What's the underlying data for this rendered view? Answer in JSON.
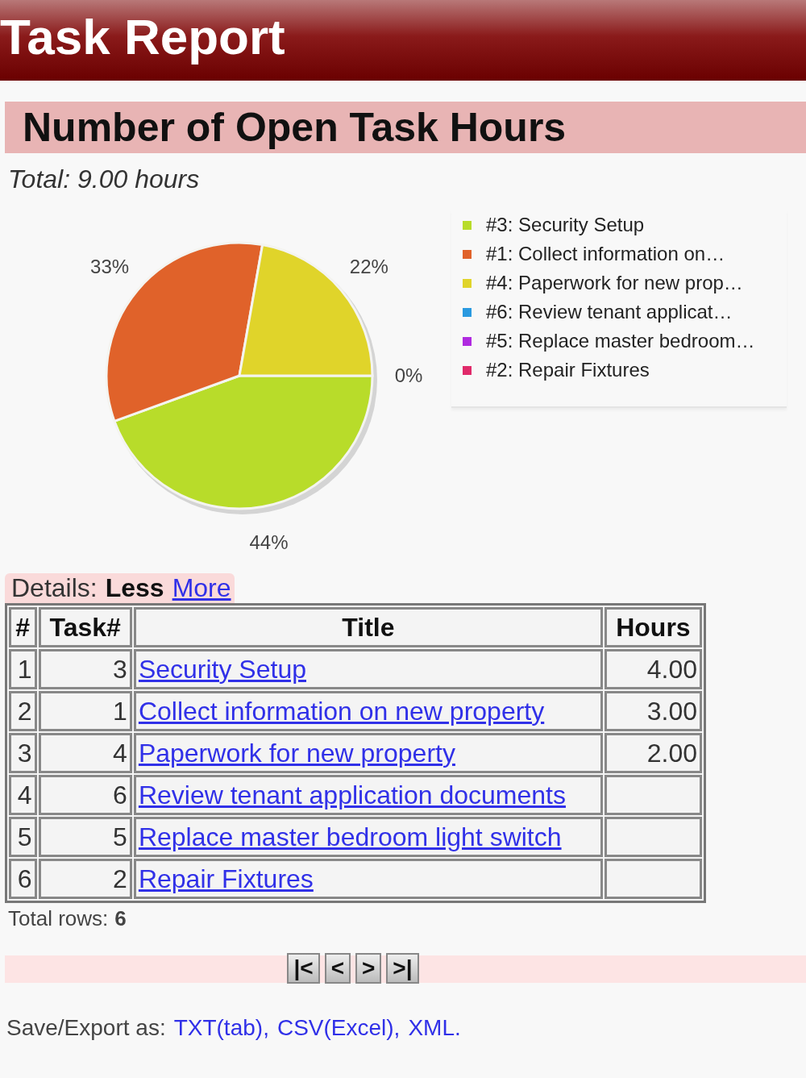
{
  "header": {
    "title": "Task Report"
  },
  "section": {
    "heading": "Number of Open Task Hours",
    "total": "Total: 9.00 hours",
    "chart_data": {
      "type": "pie",
      "categories": [
        "#3: Security Setup",
        "#1: Collect information on…",
        "#4: Paperwork for new prop…",
        "#6: Review tenant applicat…",
        "#5: Replace master bedroom…",
        "#2: Repair Fixtures"
      ],
      "values": [
        44,
        33,
        22,
        0,
        0,
        0
      ],
      "legend": "right",
      "colors": [
        "#b8dc2a",
        "#e0622a",
        "#e0d42a",
        "#2a9ae0",
        "#b02ae0",
        "#e02a6a"
      ],
      "value_labels": [
        "44%",
        "33%",
        "22%",
        "0%",
        null,
        null
      ]
    }
  },
  "details": {
    "label": "Details:",
    "options": [
      {
        "label": "Less",
        "selected": true
      },
      {
        "label": "More",
        "selected": false
      }
    ]
  },
  "table": {
    "columns": [
      "#",
      "Task#",
      "Title",
      "Hours"
    ],
    "rows": [
      {
        "index": "1",
        "task": "3",
        "title": "Security Setup",
        "hours": "4.00"
      },
      {
        "index": "2",
        "task": "1",
        "title": "Collect information on new property",
        "hours": "3.00"
      },
      {
        "index": "3",
        "task": "4",
        "title": "Paperwork for new property",
        "hours": "2.00"
      },
      {
        "index": "4",
        "task": "6",
        "title": "Review tenant application documents"
      },
      {
        "index": "5",
        "task": "5",
        "title": "Replace master bedroom light switch"
      },
      {
        "index": "6",
        "task": "2",
        "title": "Repair Fixtures"
      }
    ]
  },
  "total_rows": {
    "label": "Total rows:",
    "value": "6"
  },
  "pager": [
    "|<",
    "<",
    ">",
    ">|"
  ],
  "export": {
    "label": "Save/Export as:",
    "links": [
      {
        "label": "TXT(tab)",
        "after": ","
      },
      {
        "label": "CSV(Excel)",
        "after": ","
      },
      {
        "label": "XML",
        "after": "."
      }
    ]
  }
}
